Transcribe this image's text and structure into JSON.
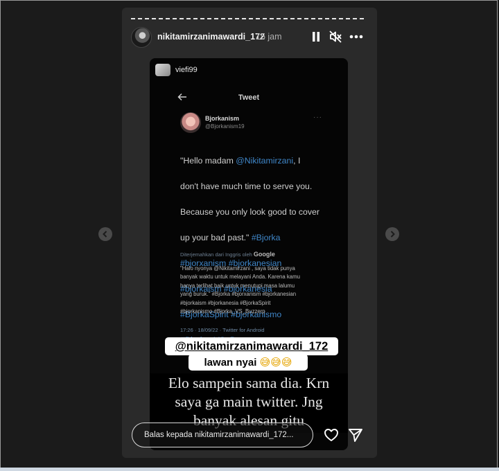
{
  "story": {
    "username": "nikitamirzanimawardi_172",
    "time_ago": "15 jam",
    "repost_username": "viefi99"
  },
  "tweet": {
    "header_title": "Tweet",
    "author_name": "Bjorkanism",
    "author_handle": "@Bjorkanism19",
    "main_text": "\"Hello madam @Nikitamirzani, I don't have much time to serve you. Because you only look good to cover up your bad past.\" #Bjorka #bjorxanism #bjorkanesian #bjorkaism #bjorkanesia #BjorkaSpirit #bjorkanismo #Bjorka_VS_Buzzerp",
    "main_lines": [
      {
        "t": "\"Hello madam ",
        "tag": "@Nikitamirzani",
        "t2": ", I"
      },
      {
        "t": "don't have much time to serve you."
      },
      {
        "t": "Because you only look good to cover"
      },
      {
        "t": "up your bad past.\" ",
        "tag": "#Bjorka"
      },
      {
        "tag": "#bjorxanism #bjorkanesian"
      },
      {
        "tag": "#bjorkaism #bjorkanesia"
      },
      {
        "tag": "#BjorkaSpirit #bjorkanismo"
      },
      {
        "tag": "#Bjorka_VS_Buzzerp"
      }
    ],
    "translated_by": "Diterjemahkan dari Inggris oleh",
    "translator": "Google",
    "translated_text": "\"Halo nyonya @Nikitamirzani , saya tidak punya\nbanyak waktu untuk melayani Anda. Karena kamu\nhanya terlihat baik untuk menutupi masa lalumu\nyang buruk.\" #Bjorka #bjorxanism #bjorkanesian\n#bjorkaism #bjorkanesia #BjorkaSpirit\n#bjorkanismo #Bjorka_VS_Buzzerp",
    "meta": "17:26 · 18/09/22 · Twitter for Android"
  },
  "stickers": {
    "mention": "@nikitamirzanimawardi_172",
    "line2_text": "lawan nyai",
    "line2_emoji": "😅😅😅"
  },
  "overlay_text": "Elo sampein sama dia. Krn\nsaya ga main twitter. Jng\nbanyak alesan gitu",
  "reply": {
    "placeholder": "Balas kepada nikitamirzanimawardi_172..."
  },
  "icons": {
    "pause": "pause-icon",
    "mute": "speaker-muted-icon",
    "more": "more-horizontal-icon",
    "back": "arrow-left-icon",
    "heart": "heart-icon",
    "send": "send-icon",
    "prev": "chevron-left-icon",
    "next": "chevron-right-icon"
  },
  "colors": {
    "background": "#1b1b1b",
    "story_bg": "#2a2a2a",
    "hashtag": "#3f86c8"
  }
}
